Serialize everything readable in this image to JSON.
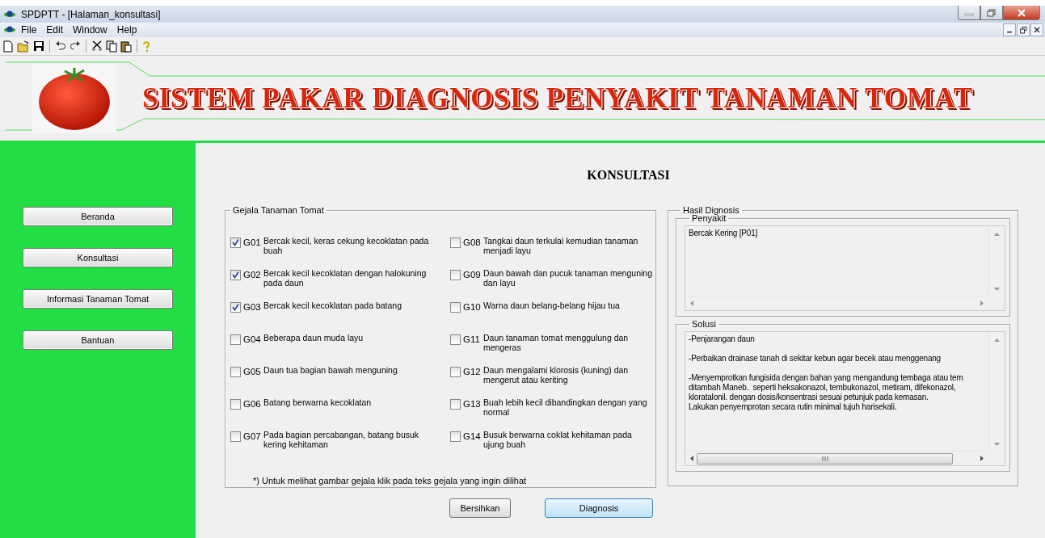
{
  "window": {
    "title": "SPDPTT - [Halaman_konsultasi]"
  },
  "menu": [
    "File",
    "Edit",
    "Window",
    "Help"
  ],
  "banner": {
    "title": "SISTEM PAKAR DIAGNOSIS PENYAKIT TANAMAN TOMAT"
  },
  "sidebar": {
    "items": [
      "Beranda",
      "Konsultasi",
      "Informasi Tanaman Tomat",
      "Bantuan"
    ]
  },
  "page_title": "KONSULTASI",
  "symptoms": {
    "legend": "Gejala Tanaman Tomat",
    "columns": [
      [
        {
          "code": "G01",
          "text": "Bercak kecil, keras cekung kecoklatan pada buah",
          "checked": true
        },
        {
          "code": "G02",
          "text": "Bercak kecil kecoklatan dengan halokuning pada daun",
          "checked": true
        },
        {
          "code": "G03",
          "text": "Bercak kecil kecoklatan pada batang",
          "checked": true
        },
        {
          "code": "G04",
          "text": "Beberapa daun muda layu",
          "checked": false
        },
        {
          "code": "G05",
          "text": "Daun tua bagian bawah menguning",
          "checked": false
        },
        {
          "code": "G06",
          "text": "Batang berwarna kecoklatan",
          "checked": false
        },
        {
          "code": "G07",
          "text": "Pada bagian percabangan, batang busuk kering kehitaman",
          "checked": false
        }
      ],
      [
        {
          "code": "G08",
          "text": "Tangkai daun terkulai kemudian tanaman menjadi layu",
          "checked": false
        },
        {
          "code": "G09",
          "text": "Daun bawah dan pucuk tanaman  menguning dan layu",
          "checked": false
        },
        {
          "code": "G10",
          "text": "Warna daun belang-belang hijau tua",
          "checked": false
        },
        {
          "code": "G11",
          "text": "Daun tanaman tomat menggulung dan mengeras",
          "checked": false
        },
        {
          "code": "G12",
          "text": "Daun mengalami klorosis (kuning) dan mengerut atau keriting",
          "checked": false
        },
        {
          "code": "G13",
          "text": "Buah lebih kecil dibandingkan dengan yang normal",
          "checked": false
        },
        {
          "code": "G14",
          "text": "Busuk berwarna coklat kehitaman pada ujung buah",
          "checked": false
        }
      ]
    ],
    "note": "*)  Untuk melihat gambar gejala klik pada teks gejala yang ingin dilihat"
  },
  "result": {
    "legend": "Hasil Dignosis",
    "disease": {
      "legend": "Penyakit",
      "value": "Bercak Kering [P01]"
    },
    "solution": {
      "legend": "Solusi",
      "paragraphs": [
        "-Penjarangan daun",
        "-Perbaikan drainase tanah di sekitar kebun agar becek atau menggenang",
        "-Menyemprotkan fungisida dengan bahan yang mengandung tembaga atau tem\nditambah Maneb.  seperti heksakonazol, tembukonazol, metiram, difekonazol,\nkloratalonil. dengan dosis/konsentrasi sesuai petunjuk pada kemasan.\nLakukan penyemprotan secara rutin minimal tujuh harisekali."
      ]
    }
  },
  "buttons": [
    {
      "label": "Bersihkan",
      "focused": false
    },
    {
      "label": "Diagnosis",
      "focused": true
    }
  ]
}
